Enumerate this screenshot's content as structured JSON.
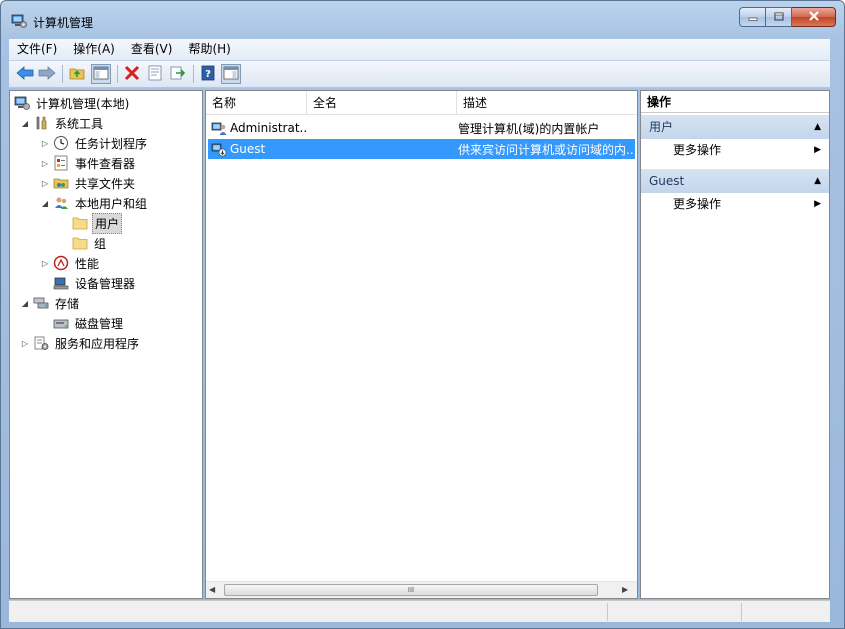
{
  "window": {
    "title": "计算机管理"
  },
  "menu": [
    "文件(F)",
    "操作(A)",
    "查看(V)",
    "帮助(H)"
  ],
  "tree": {
    "root": "计算机管理(本地)",
    "system_tools": "系统工具",
    "task_scheduler": "任务计划程序",
    "event_viewer": "事件查看器",
    "shared_folders": "共享文件夹",
    "local_users_groups": "本地用户和组",
    "users": "用户",
    "groups": "组",
    "performance": "性能",
    "device_manager": "设备管理器",
    "storage": "存储",
    "disk_management": "磁盘管理",
    "services_apps": "服务和应用程序"
  },
  "list": {
    "columns": [
      "名称",
      "全名",
      "描述"
    ],
    "rows": [
      {
        "name": "Administrat...",
        "fullname": "",
        "description": "管理计算机(域)的内置帐户"
      },
      {
        "name": "Guest",
        "fullname": "",
        "description": "供来宾访问计算机或访问域的内..."
      }
    ],
    "scroll_grip": "III"
  },
  "actions": {
    "title": "操作",
    "sections": [
      {
        "name": "用户",
        "item": "更多操作"
      },
      {
        "name": "Guest",
        "item": "更多操作"
      }
    ]
  },
  "colors": {
    "accent": "#3399ff",
    "section": "#c3d5ec"
  }
}
